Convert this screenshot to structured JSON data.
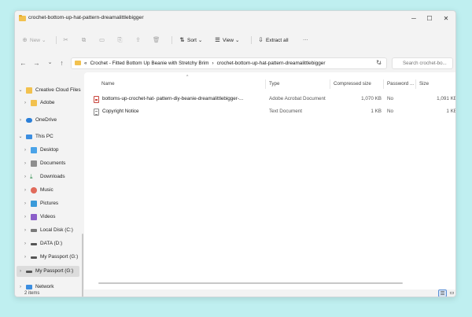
{
  "window": {
    "title": "crochet-bottom-up-hat-pattern-dreamalittlebigger"
  },
  "window_controls": {
    "minimize": "─",
    "maximize": "☐",
    "close": "✕"
  },
  "toolbar": {
    "new_label": "New",
    "sort_label": "Sort",
    "view_label": "View",
    "extract_label": "Extract all",
    "more_label": "···"
  },
  "address": {
    "overflow": "«",
    "crumbs": [
      "Crochet - Fitted Bottom Up Beanie with Stretchy Brim",
      "crochet-bottom-up-hat-pattern-dreamalittlebigger"
    ],
    "separator": "›",
    "dropdown": "⌄",
    "search_placeholder": "Search crochet-bo..."
  },
  "nav": {
    "back": "←",
    "forward": "→",
    "recent": "⌄",
    "up": "↑",
    "refresh": "↻"
  },
  "sidebar": {
    "items": [
      {
        "label": "Creative Cloud Files",
        "chevron": "⌄"
      },
      {
        "label": "Adobe",
        "chevron": "›"
      },
      {
        "label": "OneDrive",
        "chevron": "›"
      },
      {
        "label": "This PC",
        "chevron": "⌄"
      },
      {
        "label": "Desktop",
        "chevron": "›"
      },
      {
        "label": "Documents",
        "chevron": "›"
      },
      {
        "label": "Downloads",
        "chevron": "›"
      },
      {
        "label": "Music",
        "chevron": "›"
      },
      {
        "label": "Pictures",
        "chevron": "›"
      },
      {
        "label": "Videos",
        "chevron": "›"
      },
      {
        "label": "Local Disk (C:)",
        "chevron": "›"
      },
      {
        "label": "DATA (D:)",
        "chevron": "›"
      },
      {
        "label": "My Passport (G:)",
        "chevron": "›"
      },
      {
        "label": "My Passport (G:)",
        "chevron": "›"
      },
      {
        "label": "Network",
        "chevron": "›"
      }
    ]
  },
  "columns": {
    "name": "Name",
    "type": "Type",
    "compressed": "Compressed size",
    "password": "Password ...",
    "size": "Size",
    "sort_indicator": "^"
  },
  "files": [
    {
      "name": "bottoms-up-crochet-hat- pattern-diy-beanie-dreamalittlebigger-...",
      "type": "Adobe Acrobat Document",
      "compressed": "1,070 KB",
      "password": "No",
      "size": "1,091 KB"
    },
    {
      "name": "Copyright Notice",
      "type": "Text Document",
      "compressed": "1 KB",
      "password": "No",
      "size": "1 KB"
    }
  ],
  "status": {
    "count": "2 items"
  },
  "colors": {
    "folder": "#f2c14e",
    "selection": "#dcdcdc",
    "accent": "#5a8fd6",
    "pdf": "#c9463d"
  }
}
